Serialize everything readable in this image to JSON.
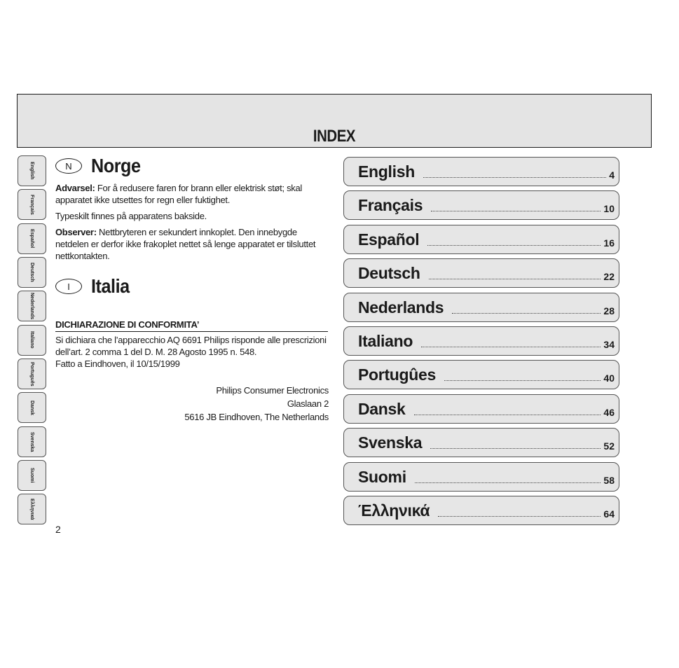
{
  "header": {
    "title": "INDEX"
  },
  "side_tabs": [
    "English",
    "Français",
    "Español",
    "Deutsch",
    "Nederlands",
    "Italiano",
    "Português",
    "Dansk",
    "Svenska",
    "Suomi",
    "Ελληνικά"
  ],
  "norge": {
    "badge": "N",
    "title": "Norge",
    "advarsel_label": "Advarsel:",
    "advarsel_text": " For å redusere faren for brann eller elektrisk støt; skal apparatet ikke utsettes for regn eller fuktighet.",
    "typeskilt": "Typeskilt finnes på apparatens bakside.",
    "observer_label": "Observer:",
    "observer_text": " Nettbryteren er sekundert innkoplet. Den innebygde netdelen er derfor ikke frakoplet nettet så lenge apparatet er tilsluttet nettkontakten."
  },
  "italia": {
    "badge": "I",
    "title": "Italia",
    "conformity_heading": "DICHIARAZIONE DI CONFORMITA’",
    "conformity_text": "Si dichiara che l’apparecchio AQ 6691 Philips risponde alle prescrizioni dell’art. 2 comma 1 del D. M. 28 Agosto 1995 n. 548.",
    "date_line": "Fatto a Eindhoven, il 10/15/1999",
    "address": [
      "Philips Consumer Electronics",
      "Glaslaan 2",
      "5616 JB Eindhoven, The Netherlands"
    ]
  },
  "page_number": "2",
  "toc": [
    {
      "label": "English",
      "page": "4"
    },
    {
      "label": "Français",
      "page": "10"
    },
    {
      "label": "Español",
      "page": "16"
    },
    {
      "label": "Deutsch",
      "page": "22"
    },
    {
      "label": "Nederlands",
      "page": "28"
    },
    {
      "label": "Italiano",
      "page": "34"
    },
    {
      "label": "Portugûes",
      "page": "40"
    },
    {
      "label": "Dansk",
      "page": "46"
    },
    {
      "label": "Svenska",
      "page": "52"
    },
    {
      "label": "Suomi",
      "page": "58"
    },
    {
      "label": "Έλληνικά",
      "page": "64"
    }
  ]
}
